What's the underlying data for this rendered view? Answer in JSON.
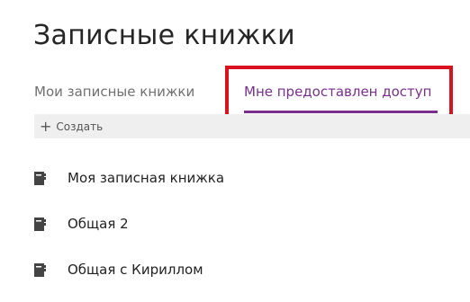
{
  "page": {
    "title": "Записные книжки"
  },
  "tabs": [
    {
      "label": "Мои записные книжки",
      "active": false
    },
    {
      "label": "Мне предоставлен доступ",
      "active": true
    }
  ],
  "toolbar": {
    "create_icon": "plus-icon",
    "create_label": "Создать"
  },
  "notebooks": [
    {
      "label": "Моя записная книжка",
      "icon": "notebook-icon"
    },
    {
      "label": "Общая 2",
      "icon": "notebook-icon"
    },
    {
      "label": "Общая с Кириллом",
      "icon": "notebook-icon"
    }
  ],
  "colors": {
    "accent": "#7a2f8f",
    "highlight": "#d8121f",
    "toolbar_bg": "#efefef"
  }
}
